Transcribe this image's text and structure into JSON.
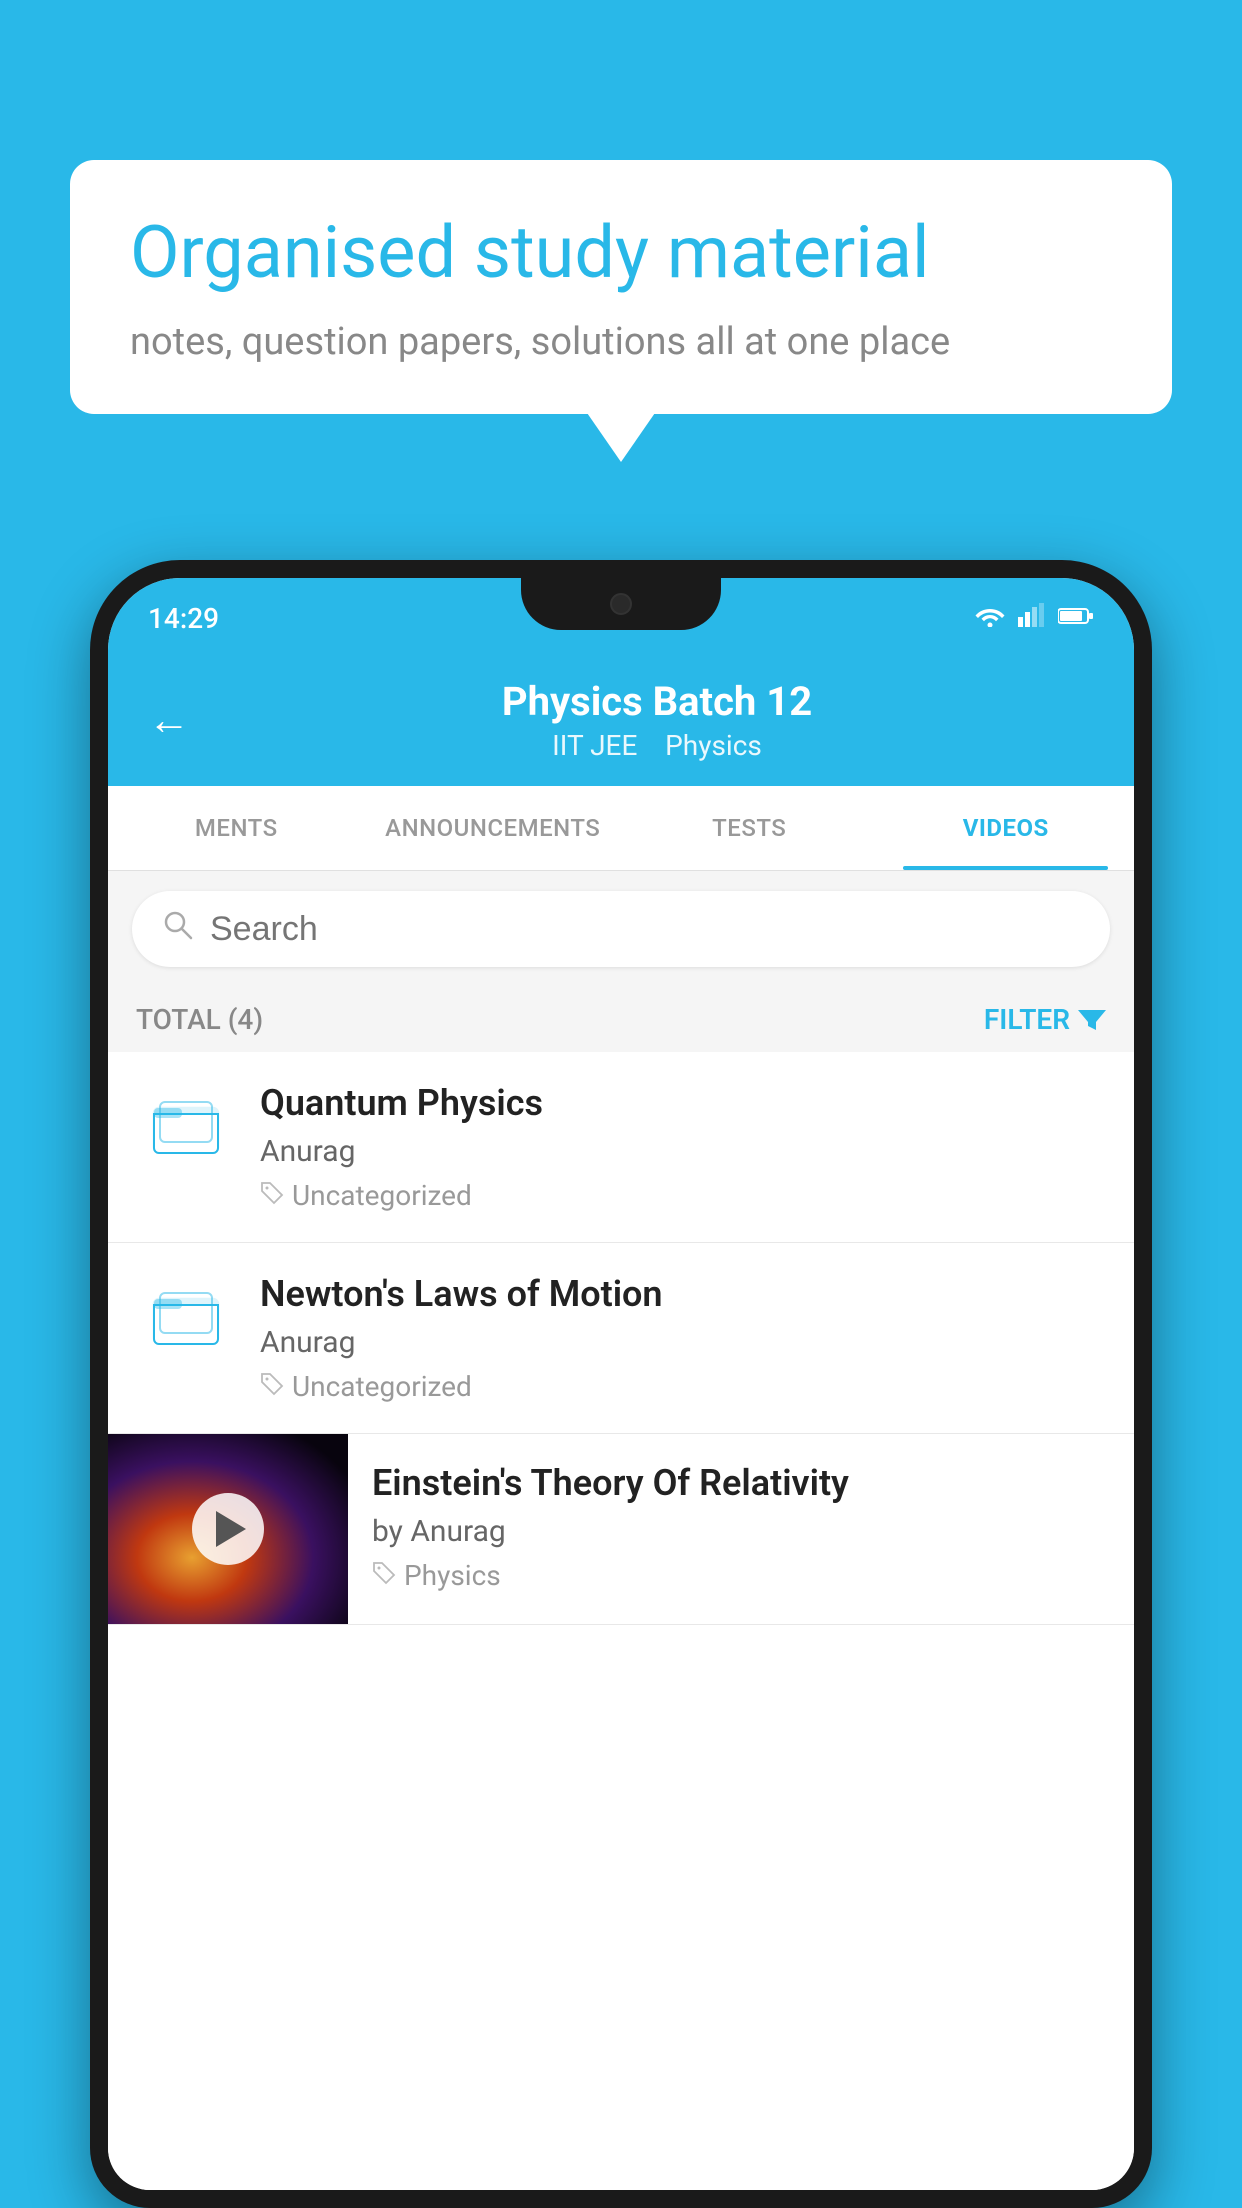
{
  "background": {
    "color": "#29b8e8"
  },
  "speech_bubble": {
    "heading": "Organised study material",
    "subtext": "notes, question papers, solutions all at one place"
  },
  "phone": {
    "status_bar": {
      "time": "14:29",
      "wifi": "▼",
      "signal": "◂▸",
      "battery": "▮"
    },
    "header": {
      "back_label": "←",
      "title": "Physics Batch 12",
      "subtitle_part1": "IIT JEE",
      "subtitle_part2": "Physics"
    },
    "tabs": [
      {
        "label": "MENTS",
        "active": false
      },
      {
        "label": "ANNOUNCEMENTS",
        "active": false
      },
      {
        "label": "TESTS",
        "active": false
      },
      {
        "label": "VIDEOS",
        "active": true
      }
    ],
    "search": {
      "placeholder": "Search"
    },
    "filter_row": {
      "total_label": "TOTAL (4)",
      "filter_label": "FILTER"
    },
    "videos": [
      {
        "title": "Quantum Physics",
        "author": "Anurag",
        "tag": "Uncategorized",
        "has_thumbnail": false
      },
      {
        "title": "Newton's Laws of Motion",
        "author": "Anurag",
        "tag": "Uncategorized",
        "has_thumbnail": false
      },
      {
        "title": "Einstein's Theory Of Relativity",
        "author": "by Anurag",
        "tag": "Physics",
        "has_thumbnail": true
      }
    ]
  }
}
